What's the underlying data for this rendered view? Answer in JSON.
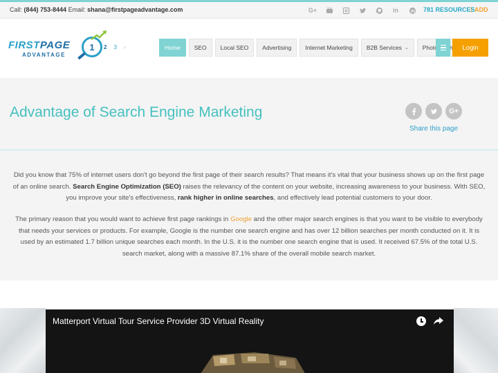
{
  "topbar": {
    "contact_prefix": "Call: ",
    "phone": "(844) 753-8444",
    "email_prefix": " Email: ",
    "email": "shana@firstpageadvantage.com",
    "social_icons": [
      "google-plus-icon",
      "youtube-icon",
      "instagram-icon",
      "twitter-icon",
      "pinterest-icon",
      "linkedin-icon",
      "wordpress-icon"
    ],
    "resources_label": "781 RESOURCES",
    "separator": "|",
    "add_label": "ADD"
  },
  "logo": {
    "word1": "FIRST",
    "word2": "PAGE",
    "word3": "ADVANTAGE",
    "number": "1"
  },
  "pager": {
    "p2": "2",
    "p3": "3",
    "next": "›"
  },
  "nav": {
    "items": [
      {
        "label": "Home",
        "active": true
      },
      {
        "label": "SEO"
      },
      {
        "label": "Local SEO"
      },
      {
        "label": "Advertising"
      },
      {
        "label": "Internet Marketing"
      },
      {
        "label": "B2B Services",
        "dropdown": true
      },
      {
        "label": "Photography"
      }
    ],
    "login_label": "Login"
  },
  "title_band": {
    "title": "Advantage of Search Engine Marketing",
    "share_label": "Share this page",
    "share_icons": [
      "facebook-icon",
      "twitter-icon",
      "google-plus-icon"
    ]
  },
  "content": {
    "p1": {
      "t1": "Did you know that 75% of internet users don't go beyond the first page of their search results? That means it's vital that your business shows up on the first page of an online search. ",
      "b1": "Search Engine Optimization (SEO)",
      "t2": " raises the relevancy of the content on your website, increasing awareness to your business. With SEO, you improve your site's effectiveness, ",
      "b2": "rank higher in online searches",
      "t3": ", and effectively lead potential customers to your door."
    },
    "p2": {
      "t1": "The primary reason that you would want to achieve first page rankings in ",
      "link": "Google",
      "t2": " and the other major search engines is that you want to be visible to everybody that needs your services or products. For example, Google is the number one search engine and has over 12 billion searches per month conducted on it. It is used by an estimated 1.7 billion unique searches each month. In the U.S. it is the number one search engine that is used. It received 67.5% of the total U.S. search market, along with a massive 87.1% share of the overall mobile search market."
    }
  },
  "video": {
    "title": "Matterport Virtual Tour Service Provider 3D Virtual Reality"
  },
  "colors": {
    "accent_teal": "#7fd3d3",
    "title_teal": "#45c0c0",
    "link_blue": "#2aa0c8",
    "login_orange": "#f5a000"
  }
}
